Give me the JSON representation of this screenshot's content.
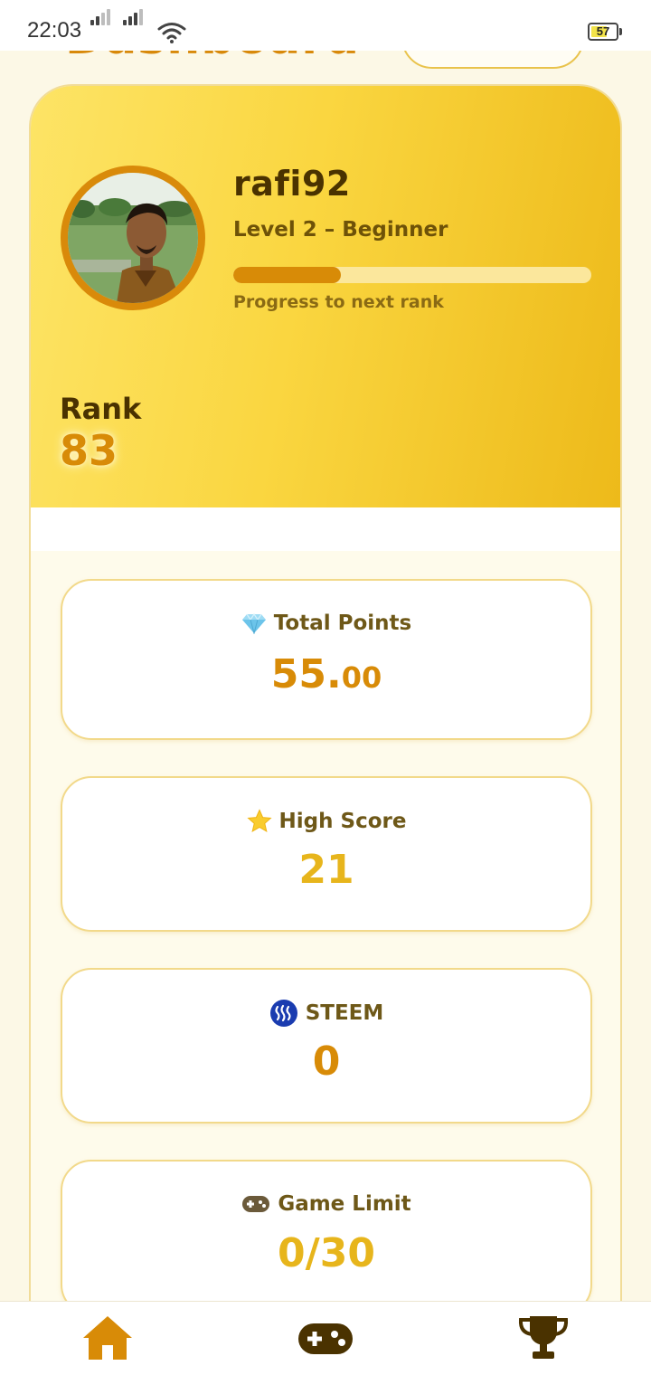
{
  "status_bar": {
    "time": "22:03",
    "battery": "57"
  },
  "header": {
    "title": "Dashboard"
  },
  "profile": {
    "username": "rafi92",
    "level": "Level 2 – Beginner",
    "progress_fraction": 0.3,
    "progress_caption": "Progress to next rank",
    "rank_label": "Rank",
    "rank_value": "83"
  },
  "stats": {
    "total_points": {
      "label": "Total Points",
      "value_int": "55.",
      "value_dec": "00",
      "icon": "gem-icon"
    },
    "high_score": {
      "label": "High Score",
      "value": "21",
      "icon": "star-icon"
    },
    "steem": {
      "label": "STEEM",
      "value": "0",
      "icon": "steem-logo-icon"
    },
    "game_limit": {
      "label": "Game Limit",
      "value": "0/30",
      "icon": "gamepad-icon"
    }
  },
  "colors": {
    "accent_orange": "#d88b07",
    "accent_yellow": "#e7b51c",
    "text_brown": "#4a3200"
  },
  "nav": {
    "items": [
      "home-icon",
      "gamepad-icon",
      "trophy-icon"
    ]
  }
}
